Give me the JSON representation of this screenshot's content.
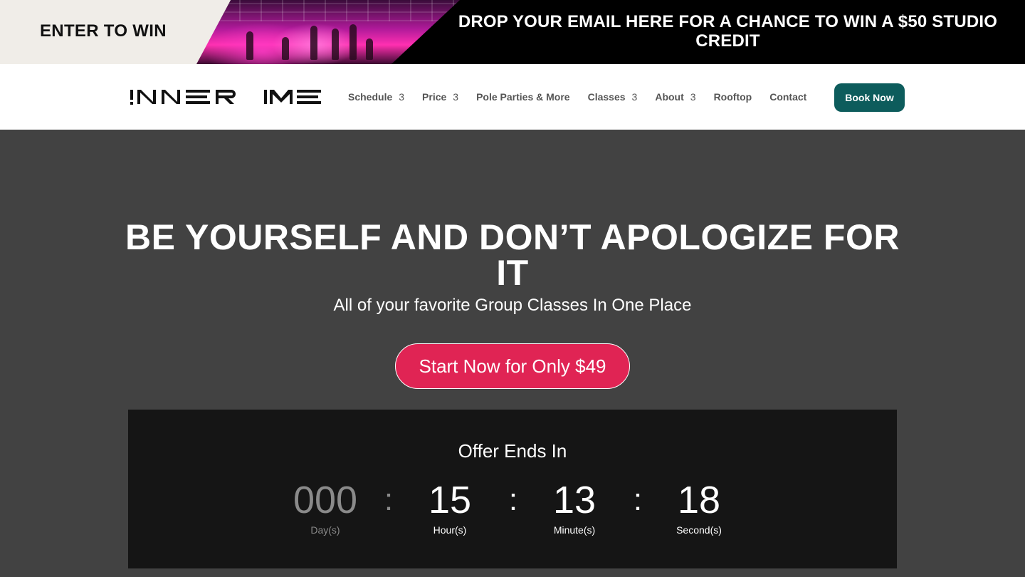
{
  "promo": {
    "left_text": "ENTER TO WIN",
    "right_text": "DROP YOUR EMAIL HERE FOR A CHANCE TO WIN A $50 STUDIO CREDIT"
  },
  "header": {
    "logo_alt": "INNER ME",
    "nav": [
      {
        "label": "Schedule",
        "chevron": "3"
      },
      {
        "label": "Price",
        "chevron": "3"
      },
      {
        "label": "Pole Parties & More",
        "chevron": ""
      },
      {
        "label": "Classes",
        "chevron": "3"
      },
      {
        "label": "About",
        "chevron": "3"
      },
      {
        "label": "Rooftop",
        "chevron": ""
      },
      {
        "label": "Contact",
        "chevron": ""
      }
    ],
    "book_label": "Book Now"
  },
  "hero": {
    "title": "BE YOURSELF AND DON’T APOLOGIZE FOR IT",
    "subtitle": "All of your favorite Group Classes In One Place",
    "cta_label": "Start Now for Only $49"
  },
  "countdown": {
    "title": "Offer Ends In",
    "days": {
      "value": "000",
      "label": "Day(s)"
    },
    "hours": {
      "value": "15",
      "label": "Hour(s)"
    },
    "minutes": {
      "value": "13",
      "label": "Minute(s)"
    },
    "seconds": {
      "value": "18",
      "label": "Second(s)"
    },
    "separator": ":"
  },
  "colors": {
    "accent_cta": "#e02454",
    "book_button": "#0d5c5c",
    "hero_bg": "#424242",
    "countdown_bg": "#151515"
  }
}
